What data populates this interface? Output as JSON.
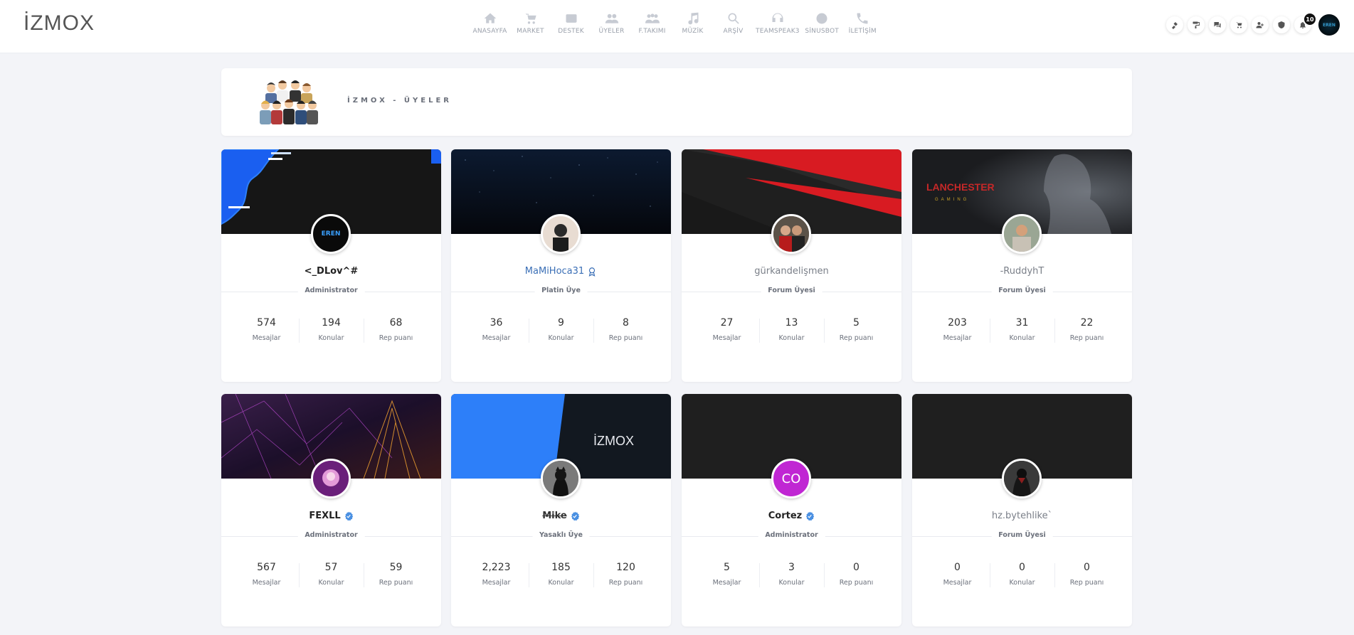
{
  "header": {
    "logo": "İZMOX",
    "nav": [
      {
        "label": "ANASAYFA",
        "icon": "home-icon"
      },
      {
        "label": "MARKET",
        "icon": "cart-icon"
      },
      {
        "label": "DESTEK",
        "icon": "support-icon"
      },
      {
        "label": "ÜYELER",
        "icon": "users-icon"
      },
      {
        "label": "F.TAKIMI",
        "icon": "team-icon"
      },
      {
        "label": "MÜZİK",
        "icon": "music-icon"
      },
      {
        "label": "ARŞİV",
        "icon": "search-icon"
      },
      {
        "label": "TEAMSPEAK3",
        "icon": "headset-icon"
      },
      {
        "label": "SİNUSBOT",
        "icon": "bot-icon"
      },
      {
        "label": "İLETİŞİM",
        "icon": "phone-icon"
      }
    ],
    "notification_count": "10",
    "avatar_text": "EREN"
  },
  "page": {
    "title": "İZMOX - ÜYELER"
  },
  "members": [
    {
      "name": "<_DLov^#",
      "role": "Administrator",
      "messages": "574",
      "topics": "194",
      "rep": "68",
      "verified": false,
      "avatar_text": "EREN"
    },
    {
      "name": "MaMiHoca31",
      "role": "Platin Üye",
      "messages": "36",
      "topics": "9",
      "rep": "8",
      "verified": false
    },
    {
      "name": "gürkandelişmen",
      "role": "Forum Üyesi",
      "messages": "27",
      "topics": "13",
      "rep": "5",
      "verified": false
    },
    {
      "name": "-RuddyhT",
      "role": "Forum Üyesi",
      "messages": "203",
      "topics": "31",
      "rep": "22",
      "verified": false,
      "banner_text_1": "LANCHESTER",
      "banner_text_2": "GAMING"
    },
    {
      "name": "FEXLL",
      "role": "Administrator",
      "messages": "567",
      "topics": "57",
      "rep": "59",
      "verified": true
    },
    {
      "name": "Mike",
      "role": "Yasaklı Üye",
      "messages": "2,223",
      "topics": "185",
      "rep": "120",
      "verified": true,
      "banner_text": "İZMOX"
    },
    {
      "name": "Cortez",
      "role": "Administrator",
      "messages": "5",
      "topics": "3",
      "rep": "0",
      "verified": true,
      "avatar_text": "CO"
    },
    {
      "name": "hz.bytehlike`",
      "role": "Forum Üyesi",
      "messages": "0",
      "topics": "0",
      "rep": "0",
      "verified": false
    }
  ],
  "labels": {
    "messages": "Mesajlar",
    "topics": "Konular",
    "rep": "Rep puanı"
  },
  "colors": {
    "verified": "#4a90e2",
    "cortez_avatar": "#c026d3",
    "mike_banner_blue": "#2d7ff9"
  }
}
